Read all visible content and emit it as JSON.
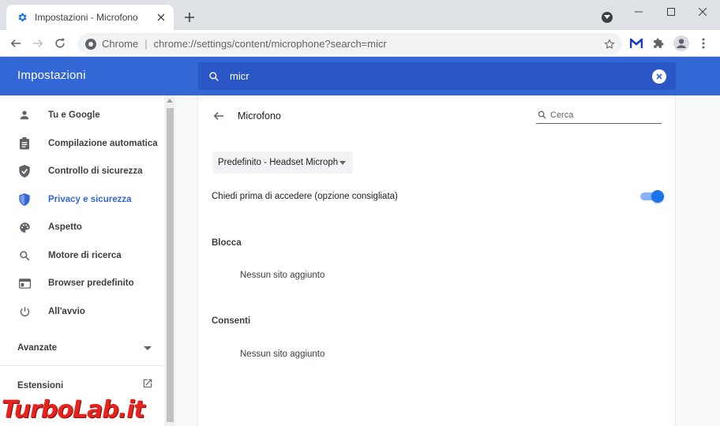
{
  "tab": {
    "title": "Impostazioni - Microfono"
  },
  "omnibox": {
    "scheme": "Chrome",
    "separator": "|",
    "url": "chrome://settings/content/microphone?search=micr"
  },
  "header": {
    "title": "Impostazioni",
    "search_value": "micr"
  },
  "sidebar": {
    "items": [
      {
        "label": "Tu e Google",
        "icon": "person-icon"
      },
      {
        "label": "Compilazione automatica",
        "icon": "clipboard-icon"
      },
      {
        "label": "Controllo di sicurezza",
        "icon": "shield-check-icon"
      },
      {
        "label": "Privacy e sicurezza",
        "icon": "shield-icon",
        "active": true
      },
      {
        "label": "Aspetto",
        "icon": "palette-icon"
      },
      {
        "label": "Motore di ricerca",
        "icon": "search-icon"
      },
      {
        "label": "Browser predefinito",
        "icon": "browser-icon"
      },
      {
        "label": "All'avvio",
        "icon": "power-icon"
      }
    ],
    "advanced": "Avanzate",
    "extensions": "Estensioni"
  },
  "main": {
    "title": "Microfono",
    "search_placeholder": "Cerca",
    "device": "Predefinito - Headset Microphone",
    "ask_label": "Chiedi prima di accedere (opzione consigliata)",
    "ask_enabled": true,
    "block": {
      "heading": "Blocca",
      "empty": "Nessun sito aggiunto"
    },
    "allow": {
      "heading": "Consenti",
      "empty": "Nessun sito aggiunto"
    }
  },
  "watermark": {
    "text": "TurboLab.it"
  },
  "colors": {
    "accent": "#3367d6",
    "search_bar": "#2a56c6",
    "toggle_on": "#1a73e8"
  }
}
